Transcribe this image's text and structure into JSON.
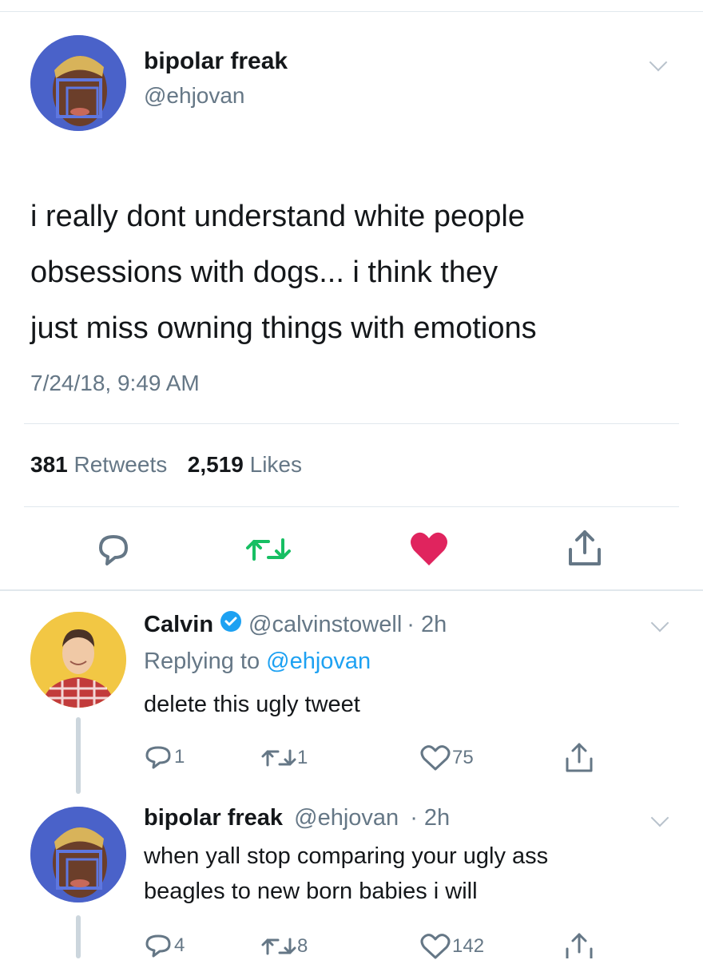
{
  "main_tweet": {
    "display_name": "bipolar freak",
    "handle": "@ehjovan",
    "text_lines": [
      "i really dont understand white people",
      "obsessions with dogs... i think they",
      "just miss owning things with emotions"
    ],
    "timestamp": "7/24/18, 9:49 AM",
    "retweets_count": "381",
    "retweets_label": "Retweets",
    "likes_count": "2,519",
    "likes_label": "Likes",
    "liked": true
  },
  "replies": [
    {
      "display_name": "Calvin",
      "verified": true,
      "handle": "@calvinstowell",
      "time": "· 2h",
      "replying_prefix": "Replying to",
      "replying_handle": "@ehjovan",
      "text_lines": [
        "delete this ugly tweet"
      ],
      "reply_count": "1",
      "retweet_count": "1",
      "like_count": "75"
    },
    {
      "display_name": "bipolar freak",
      "handle": "@ehjovan",
      "time": "· 2h",
      "text_lines": [
        "when yall stop comparing your ugly ass",
        "beagles to new born babies i will"
      ],
      "reply_count": "4",
      "retweet_count": "8",
      "like_count": "142"
    }
  ],
  "colors": {
    "like_red": "#e0245e",
    "retweet_green": "#17bf63",
    "link_blue": "#1da1f2",
    "muted": "#657786",
    "avatar_blue": "#4a62c9"
  }
}
